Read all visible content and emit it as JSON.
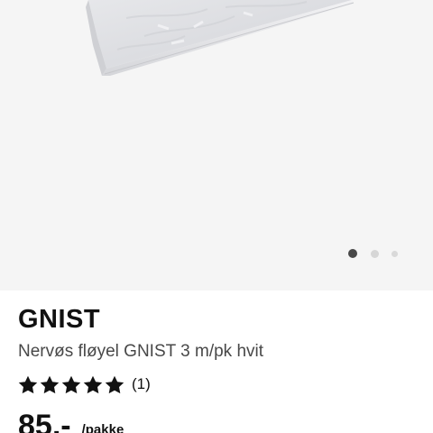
{
  "product": {
    "name": "GNIST",
    "description": "Nervøs fløyel GNIST 3 m/pk hvit",
    "rating": 5,
    "rating_max": 5,
    "review_count": "(1)",
    "price": "85,-",
    "price_unit": "/pakke"
  },
  "gallery": {
    "image_count": 3,
    "active_index": 0,
    "image_icon": "fabric-package-image"
  },
  "icons": {
    "star": "star-icon"
  },
  "colors": {
    "text_primary": "#111111",
    "text_secondary": "#484848",
    "gallery_background": "#f5f5f5",
    "dot_active": "#484848",
    "dot_inactive": "#d6d6d6"
  }
}
